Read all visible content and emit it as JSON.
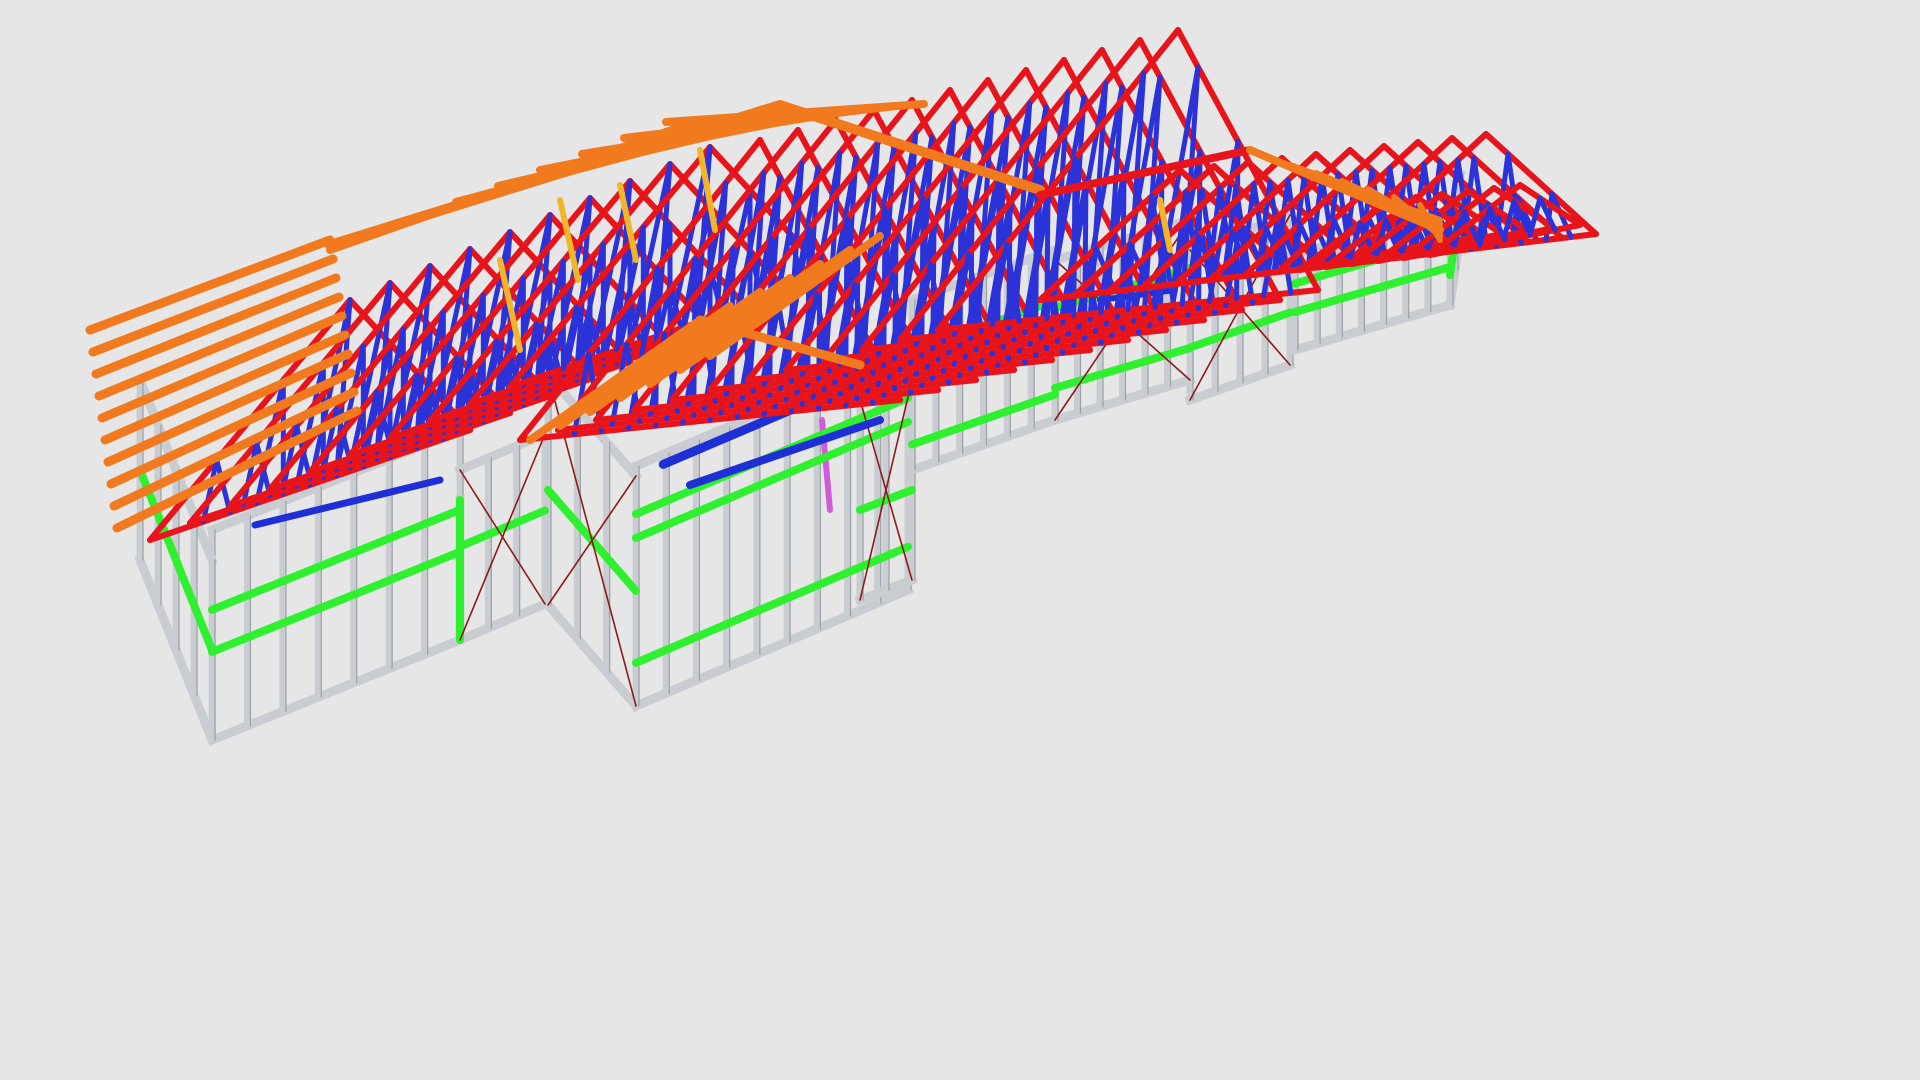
{
  "viewport": {
    "background": "#e6e6e6"
  },
  "palette": {
    "frame": "#c9cdd1",
    "frame_dark": "#9aa0a6",
    "noggin": "#2ef02e",
    "lintel": "#1f2fd6",
    "web": "#2b33d8",
    "chord": "#e8141b",
    "rafter": "#f27a1e",
    "jack": "#f1b52a",
    "brace": "#8b1a1a",
    "accent": "#d05bd8"
  },
  "legend_text": []
}
